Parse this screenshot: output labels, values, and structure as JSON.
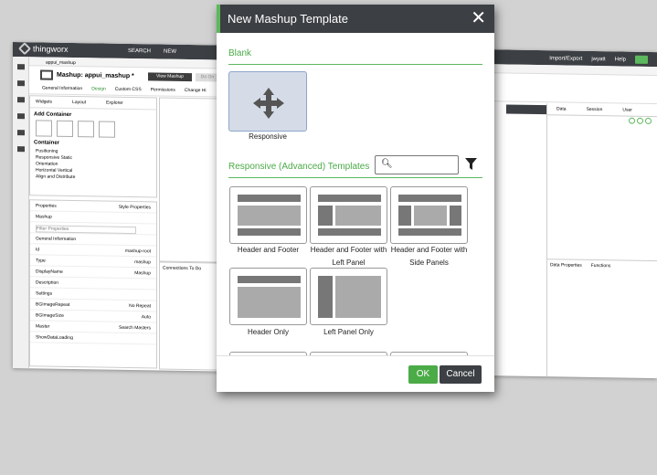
{
  "app": {
    "name": "thingworx",
    "search": "SEARCH",
    "new": "NEW",
    "user": "jwyatt",
    "import": "Import/Export",
    "help": "Help",
    "tab_item": "appui_mashup",
    "mashup_title": "Mashup: appui_mashup *",
    "view_mashup": "View Mashup",
    "do_on": "Do On",
    "design_tabs": [
      "General Information",
      "Design",
      "Custom CSS",
      "Permissions",
      "Change Hi"
    ],
    "left_tabs": [
      "Widgets",
      "Layout",
      "Explorer"
    ],
    "add_container": "Add Container",
    "container": "Container",
    "positioning": "Positioning",
    "responsive_static": "Responsive   Static",
    "orientation": "Orientation",
    "horiz_vert": "Horizontal   Vertical",
    "align_distribute": "Align and Distribute",
    "prop_tabs": [
      "Properties",
      "Style Properties"
    ],
    "mashup_label": "Mashup",
    "filter_placeholder": "Filter Properties",
    "general_info": "General Information",
    "props": [
      {
        "name": "Id",
        "value": "mashup-root"
      },
      {
        "name": "Type",
        "value": "mashup"
      },
      {
        "name": "DisplayName",
        "value": "Mashup"
      },
      {
        "name": "Description",
        "value": ""
      }
    ],
    "settings": "Settings",
    "settings_props": [
      {
        "name": "BGImageRepeat",
        "value": "No Repeat"
      },
      {
        "name": "BGImageSize",
        "value": "Auto"
      },
      {
        "name": "Master",
        "value": "Search Masters"
      },
      {
        "name": "ShowDataLoading",
        "value": ""
      }
    ],
    "connections": "Connections",
    "todo": "To Do",
    "right_tabs": [
      "Data",
      "Session",
      "User"
    ],
    "data_props": "Data Properties",
    "functions": "Functions"
  },
  "modal": {
    "title": "New Mashup Template",
    "blank_header": "Blank",
    "blank_label": "Responsive",
    "advanced_header": "Responsive (Advanced) Templates",
    "search_value": "",
    "templates": [
      {
        "label": "Header and Footer"
      },
      {
        "label": "Header and Footer with Left Panel"
      },
      {
        "label": "Header and Footer with Side Panels"
      },
      {
        "label": "Header Only"
      },
      {
        "label": "Left Panel Only"
      }
    ],
    "ok": "OK",
    "cancel": "Cancel"
  },
  "colors": {
    "accent": "#5cb85c",
    "header": "#3c3f43"
  }
}
